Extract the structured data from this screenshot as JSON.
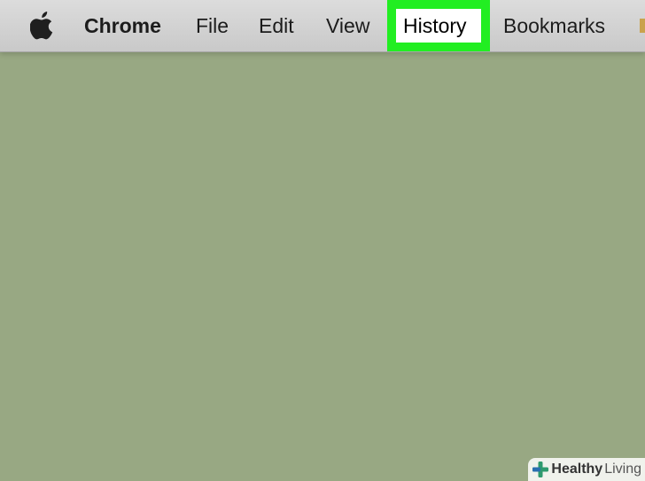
{
  "menubar": {
    "apple_icon": "apple-logo-icon",
    "items": [
      {
        "label": "Chrome"
      },
      {
        "label": "File"
      },
      {
        "label": "Edit"
      },
      {
        "label": "View"
      },
      {
        "label": "History"
      },
      {
        "label": "Bookmarks"
      }
    ],
    "highlighted": "History",
    "highlight_color": "#22ee22"
  },
  "watermark": {
    "icon": "plus-icon",
    "part1": "Healthy",
    "part2": "Living"
  },
  "colors": {
    "desktop": "#98a883",
    "menubar": "#d2d2d2"
  }
}
